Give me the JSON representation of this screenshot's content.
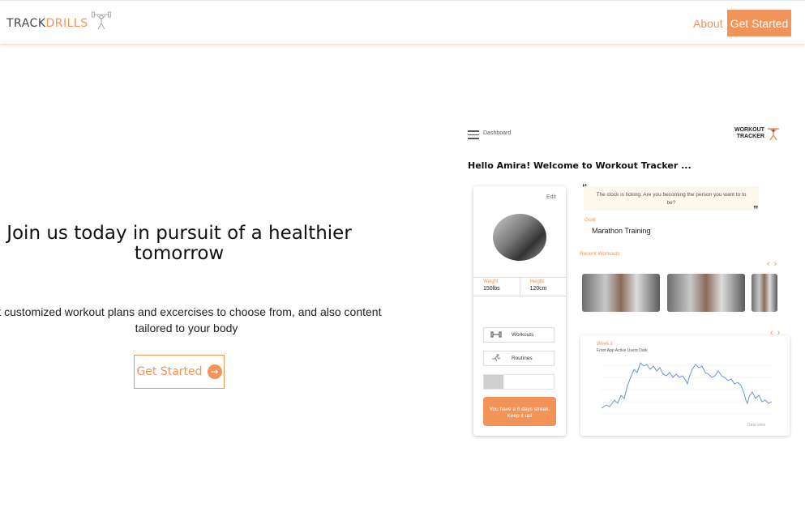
{
  "header": {
    "brand_left": "TRACK",
    "brand_right": "DRILLS",
    "about_link": "About",
    "cta_label": "Get Started",
    "logo_icon": "weightlifter-icon"
  },
  "hero": {
    "title": "Join us today in pursuit of a healthier tomorrow",
    "subtitle": "et customized workout plans and excercises to choose from, and also content tailored to your body",
    "cta_label": "Get Started",
    "cta_icon": "arrow-right-circle-icon"
  },
  "mockup": {
    "nav_label": "Dashboard",
    "logo_line1": "WORKOUT",
    "logo_line2": "TRACKER",
    "greeting": "Hello Amira! Welcome to Workout Tracker ...",
    "profile": {
      "edit_label": "Edit",
      "weight_label": "Weight",
      "weight_value": "150lbs",
      "height_label": "Height",
      "height_value": "120cm",
      "workouts_label": "Workouts",
      "routines_label": "Routines",
      "progress_fraction": 0.28,
      "streak_text": "You have a 6 days streak. Keep it up!"
    },
    "quote": "The clock is ticking. Are you becoming the person you want to to be?",
    "goal_label": "Goal",
    "goal_value": "Marathon Training",
    "recent_label": "Recent Workouts",
    "chart": {
      "week_label": "Week 1",
      "title": "Front App Active Users Dark",
      "footer": "Data view"
    }
  },
  "colors": {
    "accent": "#f2945a",
    "quote_bg": "#fdf8ec"
  }
}
